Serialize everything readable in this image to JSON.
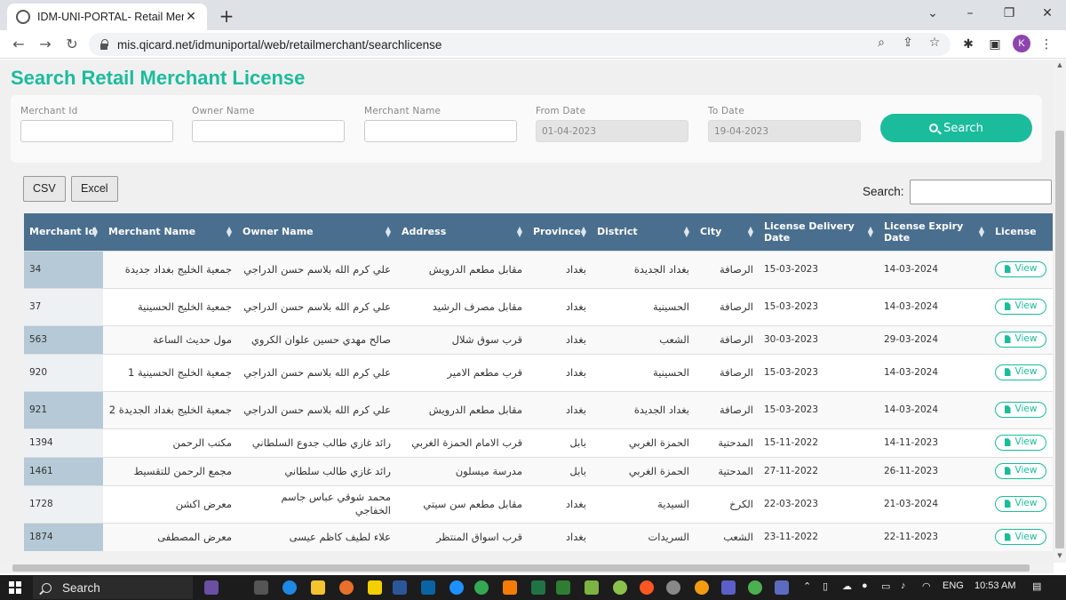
{
  "browser": {
    "tab_title": "IDM-UNI-PORTAL- Retail Mercha",
    "url": "mis.qicard.net/idmuniportal/web/retailmerchant/searchlicense",
    "profile_initial": "K"
  },
  "page": {
    "title": "Search Retail Merchant License"
  },
  "filters": {
    "merchant_id_label": "Merchant Id",
    "owner_name_label": "Owner Name",
    "merchant_name_label": "Merchant Name",
    "from_date_label": "From Date",
    "from_date_value": "01-04-2023",
    "to_date_label": "To Date",
    "to_date_value": "19-04-2023",
    "search_label": "Search"
  },
  "export": {
    "csv_label": "CSV",
    "excel_label": "Excel"
  },
  "table_search_label": "Search:",
  "table": {
    "headers": [
      "Merchant Id",
      "Merchant Name",
      "Owner Name",
      "Address",
      "Province",
      "District",
      "City",
      "License Delivery Date",
      "License Expiry Date",
      "License"
    ],
    "view_label": "View",
    "rows": [
      {
        "id": "34",
        "merchant_name": "جمعية الخليج بغداد جديدة",
        "owner_name": "علي كرم الله بلاسم حسن الدراجي",
        "address": "مقابل مطعم الدرويش",
        "province": "بغداد",
        "district": "بغداد الجديدة",
        "city": "الرصافة",
        "delivery": "15-03-2023",
        "expiry": "14-03-2024"
      },
      {
        "id": "37",
        "merchant_name": "جمعية الخليج الحسينية",
        "owner_name": "علي كرم الله بلاسم حسن الدراجي",
        "address": "مقابل مصرف الرشيد",
        "province": "بغداد",
        "district": "الحسينية",
        "city": "الرصافة",
        "delivery": "15-03-2023",
        "expiry": "14-03-2024"
      },
      {
        "id": "563",
        "merchant_name": "مول حديث الساعة",
        "owner_name": "صالح مهدي حسين علوان الكروي",
        "address": "قرب سوق شلال",
        "province": "بغداد",
        "district": "الشعب",
        "city": "الرصافة",
        "delivery": "30-03-2023",
        "expiry": "29-03-2024"
      },
      {
        "id": "920",
        "merchant_name": "جمعية الخليج الحسينية 1",
        "owner_name": "علي كرم الله بلاسم حسن الدراجي",
        "address": "قرب مطعم الامير",
        "province": "بغداد",
        "district": "الحسينية",
        "city": "الرصافة",
        "delivery": "15-03-2023",
        "expiry": "14-03-2024"
      },
      {
        "id": "921",
        "merchant_name": "جمعية الخليج بغداد الجديدة 2",
        "owner_name": "علي كرم الله بلاسم حسن الدراجي",
        "address": "مقابل مطعم الدرويش",
        "province": "بغداد",
        "district": "بغداد الجديدة",
        "city": "الرصافة",
        "delivery": "15-03-2023",
        "expiry": "14-03-2024"
      },
      {
        "id": "1394",
        "merchant_name": "مكتب الرحمن",
        "owner_name": "رائد غازي طالب جدوع السلطاني",
        "address": "قرب الامام الحمزة الغربي",
        "province": "بابل",
        "district": "الحمزة الغربي",
        "city": "المدحتية",
        "delivery": "15-11-2022",
        "expiry": "14-11-2023"
      },
      {
        "id": "1461",
        "merchant_name": "مجمع الرحمن للتقسيط",
        "owner_name": "رائد غازي طالب سلطاني",
        "address": "مدرسة ميسلون",
        "province": "بابل",
        "district": "الحمزة الغربي",
        "city": "المدحتية",
        "delivery": "27-11-2022",
        "expiry": "26-11-2023"
      },
      {
        "id": "1728",
        "merchant_name": "معرض اكشن",
        "owner_name": "محمد شوقي عباس جاسم الخفاجي",
        "address": "مقابل مطعم سن سيتي",
        "province": "بغداد",
        "district": "السيدية",
        "city": "الكرخ",
        "delivery": "22-03-2023",
        "expiry": "21-03-2024"
      },
      {
        "id": "1874",
        "merchant_name": "معرض المصطفى",
        "owner_name": "علاء لطيف كاظم عيسى",
        "address": "قرب اسواق المنتظر",
        "province": "بغداد",
        "district": "السريدات",
        "city": "الشعب",
        "delivery": "23-11-2022",
        "expiry": "22-11-2023"
      }
    ]
  },
  "taskbar": {
    "search_label": "Search",
    "language": "ENG",
    "time": "10:53 AM"
  }
}
